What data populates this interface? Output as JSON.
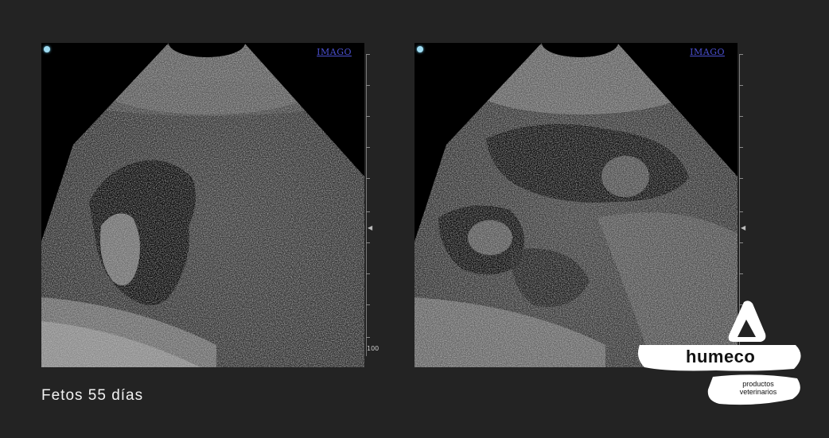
{
  "images": [
    {
      "name": "ultrasound-left",
      "device_mark": "IMAGO",
      "depth_end_label": "100"
    },
    {
      "name": "ultrasound-right",
      "device_mark": "IMAGO",
      "depth_end_label": ""
    }
  ],
  "caption": "Fetos 55 días",
  "logo": {
    "name": "humeco",
    "tagline_line1": "productos",
    "tagline_line2": "veterinarios"
  },
  "colors": {
    "background": "#232323",
    "caption_text": "#f2f2f2",
    "device_mark": "#4a4fcf",
    "logo_fill": "#ffffff"
  }
}
